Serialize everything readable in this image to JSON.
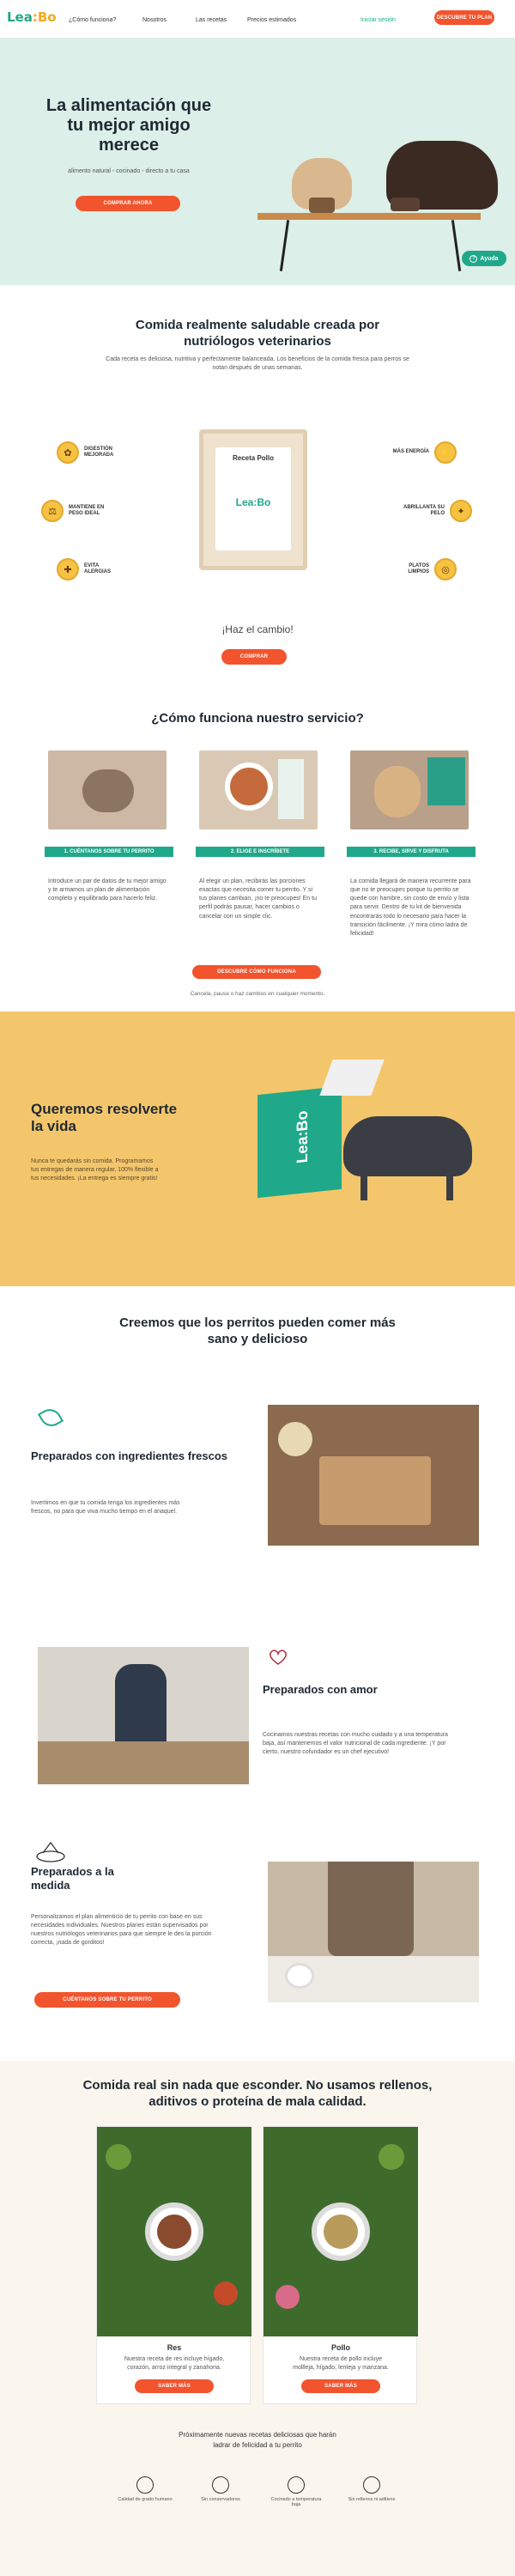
{
  "nav": {
    "logo_main": "Lea",
    "logo_accent": "Bo",
    "links": [
      "¿Cómo funciona?",
      "Nosotros",
      "Las recetas",
      "Precios estimados"
    ],
    "login": "Iniciar sesión",
    "cta": "DESCUBRE TU PLAN"
  },
  "hero": {
    "title": "La alimentación que tu mejor amigo merece",
    "subtitle": "alimento natural - cocinado - directo a tu casa",
    "cta": "COMPRAR AHORA",
    "help": "Ayuda"
  },
  "healthy": {
    "title": "Comida realmente saludable creada por nutriólogos veterinarios",
    "text": "Cada receta es deliciosa, nutritiva y perfectamente balanceada. Los beneficios de la comida fresca para perros se notan después de unas semanas.",
    "benefits_left": [
      "DIGESTIÓN MEJORADA",
      "MANTIENE EN PESO IDEAL",
      "EVITA ALERGIAS"
    ],
    "benefits_right": [
      "MÁS ENERGÍA",
      "ABRILLANTA SU PELO",
      "PLATOS LIMPIOS"
    ],
    "package_name": "Receta Pollo",
    "package_logo": "Lea:Bo",
    "tagline": "¡Haz el cambio!",
    "cta": "COMPRAR"
  },
  "how": {
    "title": "¿Cómo funciona nuestro servicio?",
    "steps": [
      {
        "label": "1. CUÉNTANOS SOBRE TU PERRITO",
        "text": "Introduce un par de datos de tu mejor amigo y te armamos un plan de alimentación completo y equilibrado para hacerlo feliz."
      },
      {
        "label": "2. ELIGE E INSCRÍBETE",
        "text": "Al elegir un plan, recibirás las porciones exactas que necesita comer tu perrito. Y si tus planes cambian, ¡no te preocupes! En tu perfil podrás pausar, hacer cambios o cancelar con un simple clic."
      },
      {
        "label": "3. RECIBE, SIRVE Y DISFRUTA",
        "text": "La comida llegará de manera recurrente para que no te preocupes porque tu perrito se quede con hambre, sin costo de envío y lista para servir. Dentro de tu kit de bienvenida encontrarás todo lo necesario para hacer la transición fácilmente. ¡Y mira cómo ladra de felicidad!"
      }
    ],
    "cta": "DESCUBRE CÓMO FUNCIONA",
    "note": "Cancela, pausa o haz cambios en cualquier momento."
  },
  "solve": {
    "title": "Queremos resolverte la vida",
    "text": "Nunca te quedarás sin comida. Programamos tus entregas de manera regular, 100% flexible a tus necesidades. ¡La entrega es siempre gratis!",
    "box_logo": "Lea:Bo"
  },
  "believe": {
    "title": "Creemos que los perritos pueden comer más sano y delicioso",
    "items": [
      {
        "title": "Preparados con ingredientes frescos",
        "text": "Invertimos en que tu comida tenga los ingredientes más frescos, no para que viva mucho tiempo en el anaquel."
      },
      {
        "title": "Preparados con amor",
        "text": "Cocinamos nuestras recetas con mucho cuidado y a una temperatura baja, así mantenemos el valor nutricional de cada ingrediente. ¡Y por cierto, nuestro cofundador es un chef ejecutivo!"
      },
      {
        "title": "Preparados a la medida",
        "text": "Personalizamos el plan alimenticio de tu perrito con base en sus necesidades individuales. Nuestros planes están supervisados por nuestros nutriólogos veterinarios para que siempre le des la porción correcta, ¡nada de gorditos!"
      }
    ],
    "cta": "CUÉNTANOS SOBRE TU PERRITO"
  },
  "food": {
    "title": "Comida real sin nada que esconder. No usamos rellenos, aditivos o proteína de mala calidad.",
    "recipes": [
      {
        "name": "Res",
        "text": "Nuestra receta de res incluye hígado, corazón, arroz integral y zanahoria.",
        "cta": "SABER MÁS"
      },
      {
        "name": "Pollo",
        "text": "Nuestra receta de pollo incluye mollleja, hígado, lenteja y manzana.",
        "cta": "SABER MÁS"
      }
    ],
    "coming": "Próximamente nuevas recetas deliciosas que harán ladrar de felicidad a tu perrito",
    "features": [
      "Calidad de grado humano",
      "Sin conservadores",
      "Cocinado a temperatura baja",
      "Sin rellenos ni aditivos"
    ]
  },
  "colors": {
    "brand_green": "#1fa88a",
    "brand_orange": "#f2542d",
    "hero_bg": "#dcefe8",
    "yellow_bg": "#f4c66c"
  }
}
